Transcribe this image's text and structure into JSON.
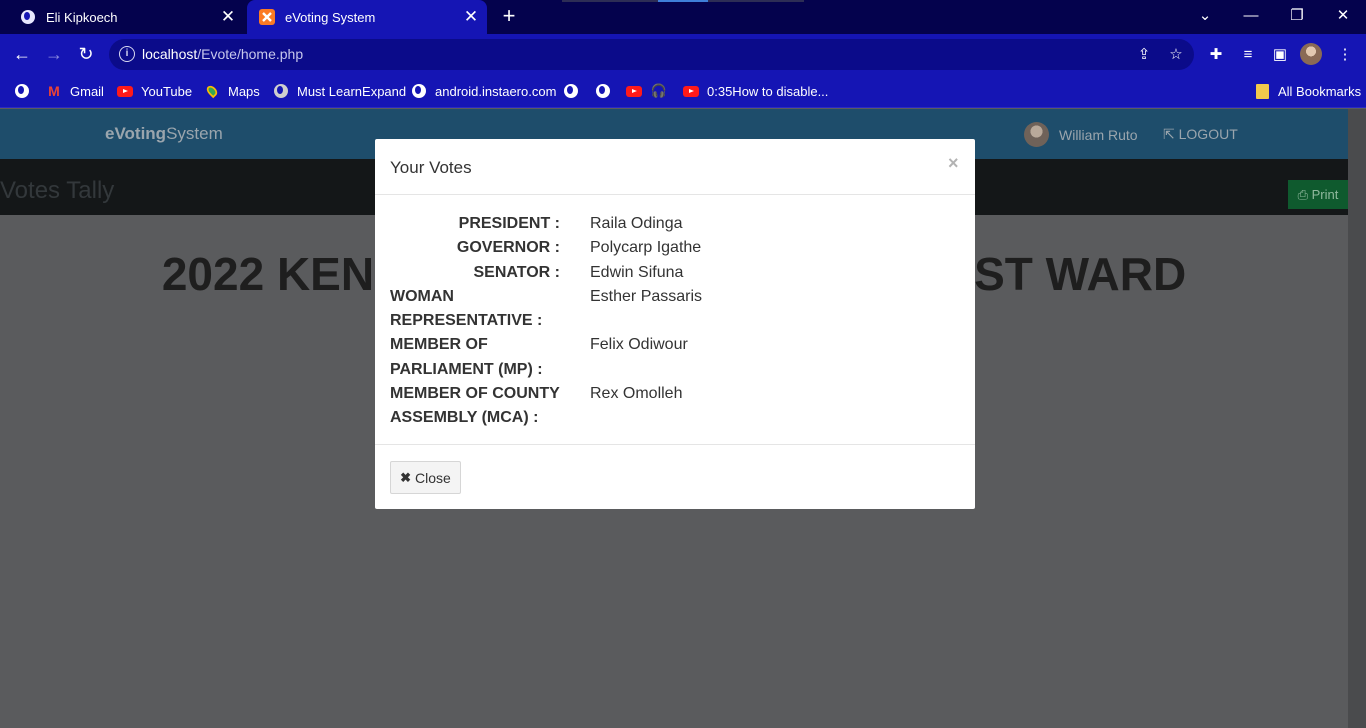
{
  "browser": {
    "tabs": [
      {
        "title": "Eli Kipkoech",
        "active": false
      },
      {
        "title": "eVoting System",
        "active": true
      }
    ],
    "url_host": "localhost",
    "url_path": "/Evote/home.php",
    "bookmarks": [
      {
        "label": "Gmail",
        "icon": "gmail-icon"
      },
      {
        "label": "YouTube",
        "icon": "youtube-icon"
      },
      {
        "label": "Maps",
        "icon": "maps-icon"
      },
      {
        "label": "Must LearnExpand",
        "icon": "site-icon"
      },
      {
        "label": "android.instaero.com",
        "icon": "globe-icon"
      },
      {
        "label": "0:35How to disable...",
        "icon": "youtube-icon"
      }
    ],
    "all_bookmarks": "All Bookmarks"
  },
  "app": {
    "brand_bold": "eVoting",
    "brand_rest": "System",
    "user_name": "William Ruto",
    "logout_label": "LOGOUT",
    "section_title": "Votes Tally",
    "print_label": "Print",
    "big_title_left": "2022 KEN",
    "big_title_right": "ST WARD"
  },
  "modal": {
    "title": "Your Votes",
    "close_x": "×",
    "close_label": "Close",
    "votes": [
      {
        "position": "PRESIDENT :",
        "candidate": "Raila Odinga",
        "multiline": false
      },
      {
        "position": "GOVERNOR :",
        "candidate": "Polycarp Igathe",
        "multiline": false
      },
      {
        "position": "SENATOR :",
        "candidate": "Edwin Sifuna",
        "multiline": false
      },
      {
        "position": "WOMAN REPRESENTATIVE :",
        "candidate": "Esther Passaris",
        "multiline": true
      },
      {
        "position": "MEMBER OF PARLIAMENT (MP) :",
        "candidate": "Felix Odiwour",
        "multiline": true
      },
      {
        "position": "MEMBER OF COUNTY ASSEMBLY (MCA) :",
        "candidate": "Rex Omolleh",
        "multiline": true
      }
    ]
  },
  "colors": {
    "tabstrip": "#04024d",
    "toolbar": "#1515b4",
    "backdrop": "#5a5b5d",
    "app_nav": "#1e4d6b",
    "print_button": "#0f5a2e"
  }
}
